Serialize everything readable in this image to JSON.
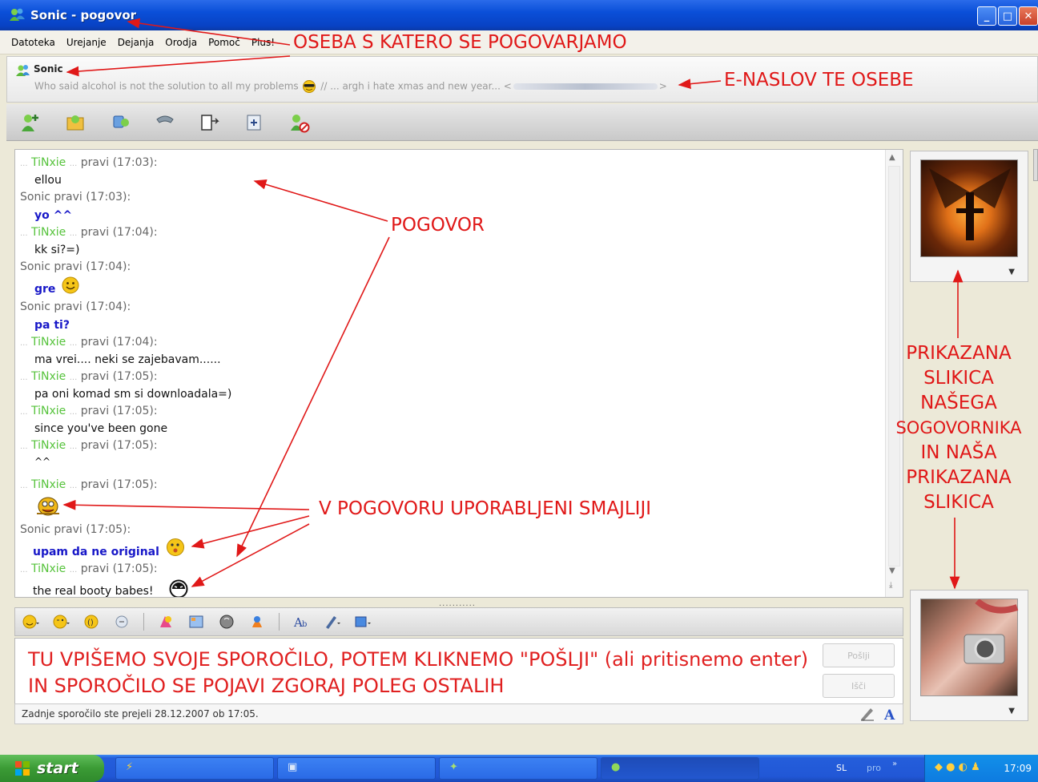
{
  "window": {
    "title": "Sonic - pogovor",
    "btn_min": "_",
    "btn_max": "□",
    "btn_close": "✕"
  },
  "menu": [
    "Datoteka",
    "Urejanje",
    "Dejanja",
    "Orodja",
    "Pomoč",
    "Plus!"
  ],
  "contact": {
    "name": "Sonic",
    "status_before": "Who said alcohol is not the solution to all my problems",
    "status_after": "//  ... argh i hate xmas and new year... <",
    "status_end": ">"
  },
  "chat": {
    "messages": [
      {
        "nick": "TiNxie",
        "tail": "pravi (17:03):",
        "body": "ellou",
        "style": "plain",
        "dots": true
      },
      {
        "nick": "",
        "tail": "Sonic pravi (17:03):",
        "body": "yo ^^",
        "style": "blue",
        "dots": false
      },
      {
        "nick": "TiNxie",
        "tail": "pravi (17:04):",
        "body": "kk si?=)",
        "style": "plain",
        "dots": true
      },
      {
        "nick": "",
        "tail": "Sonic pravi (17:04):",
        "body": "gre",
        "style": "blue",
        "dots": false
      },
      {
        "nick": "",
        "tail": "Sonic pravi (17:04):",
        "body": "pa ti?",
        "style": "blue",
        "dots": false
      },
      {
        "nick": "TiNxie",
        "tail": "pravi (17:04):",
        "body": "ma vrei.... neki se zajebavam......",
        "style": "plain",
        "dots": true
      },
      {
        "nick": "TiNxie",
        "tail": "pravi (17:05):",
        "body": "pa oni komad sm si downloadala=)",
        "style": "plain",
        "dots": true
      },
      {
        "nick": "TiNxie",
        "tail": "pravi (17:05):",
        "body": "since you've been gone",
        "style": "plain",
        "dots": true
      },
      {
        "nick": "TiNxie",
        "tail": "pravi (17:05):",
        "body": "^^",
        "style": "plain",
        "dots": true
      },
      {
        "nick": "TiNxie",
        "tail": "pravi (17:05):",
        "body": "",
        "style": "plain",
        "dots": true
      },
      {
        "nick": "",
        "tail": "Sonic pravi (17:05):",
        "body": "upam da ne original",
        "style": "blue",
        "dots": false
      },
      {
        "nick": "TiNxie",
        "tail": "pravi (17:05):",
        "body": "the real booty babes!",
        "style": "plain",
        "dots": true
      }
    ],
    "splitter": "..........."
  },
  "input": {
    "text": "TU VPIŠEMO SVOJE SPOROČILO, POTEM KLIKNEMO \"POŠLJI\" (ali pritisnemo enter) IN SPOROČILO SE POJAVI ZGORAJ POLEG OSTALIH",
    "send_label": "Pošlji",
    "search_label": "Išči"
  },
  "statusbar": {
    "text": "Zadnje sporočilo ste prejeli 28.12.2007 ob 17:05."
  },
  "taskbar": {
    "start_label": "start",
    "lang": "SL",
    "pro": "pro",
    "chevron": "»",
    "time": "17:09"
  },
  "annotations": {
    "contact": "OSEBA S KATERO SE POGOVARJAMO",
    "email": "E-NASLOV TE OSEBE",
    "conversation": "POGOVOR",
    "smileys": "V POGOVORU UPORABLJENI SMAJLIJI",
    "pictures": [
      "PRIKAZANA",
      "SLIKICA",
      "NAŠEGA",
      "SOGOVORNIKA",
      "IN NAŠA",
      "PRIKAZANA",
      "SLIKICA"
    ]
  },
  "colors": {
    "annotation": "#e01818",
    "nick": "#56c33c",
    "self_text": "#1818c8",
    "titlebar": "#0a4fd8",
    "start": "#3b9b35"
  }
}
